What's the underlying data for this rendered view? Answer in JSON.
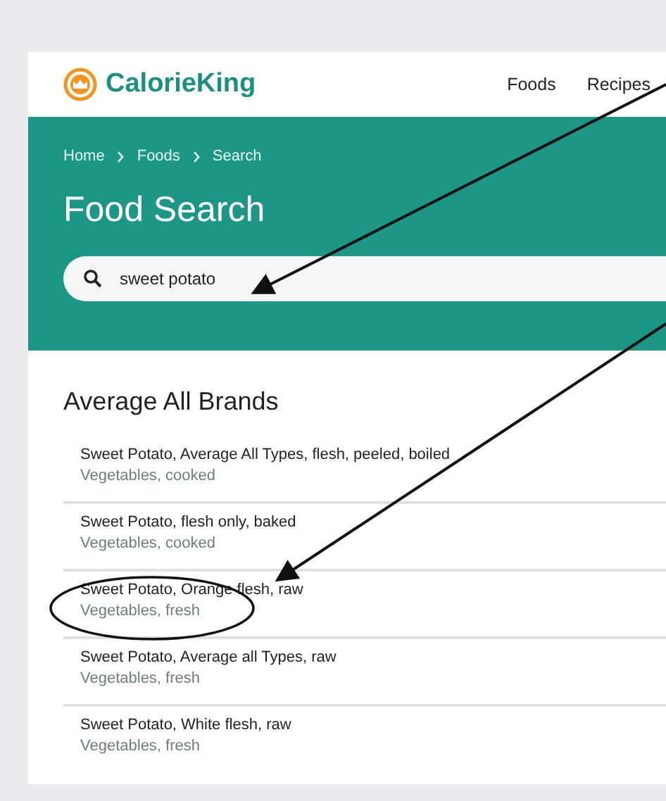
{
  "header": {
    "logo": "CalorieKing",
    "nav": [
      {
        "label": "Foods"
      },
      {
        "label": "Recipes"
      }
    ]
  },
  "breadcrumb": [
    "Home",
    "Foods",
    "Search"
  ],
  "title": "Food Search",
  "search": {
    "value": "sweet potato"
  },
  "section_title": "Average All Brands",
  "results": [
    {
      "name": "Sweet Potato, Average All Types, flesh, peeled, boiled",
      "category": "Vegetables, cooked"
    },
    {
      "name": "Sweet Potato, flesh only, baked",
      "category": "Vegetables, cooked"
    },
    {
      "name": "Sweet Potato, Orange flesh, raw",
      "category": "Vegetables, fresh"
    },
    {
      "name": "Sweet Potato, Average all Types, raw",
      "category": "Vegetables, fresh"
    },
    {
      "name": "Sweet Potato, White flesh, raw",
      "category": "Vegetables, fresh"
    }
  ],
  "annotations": [
    {
      "kind": "arrow"
    },
    {
      "kind": "arrow"
    },
    {
      "kind": "ellipse"
    }
  ]
}
